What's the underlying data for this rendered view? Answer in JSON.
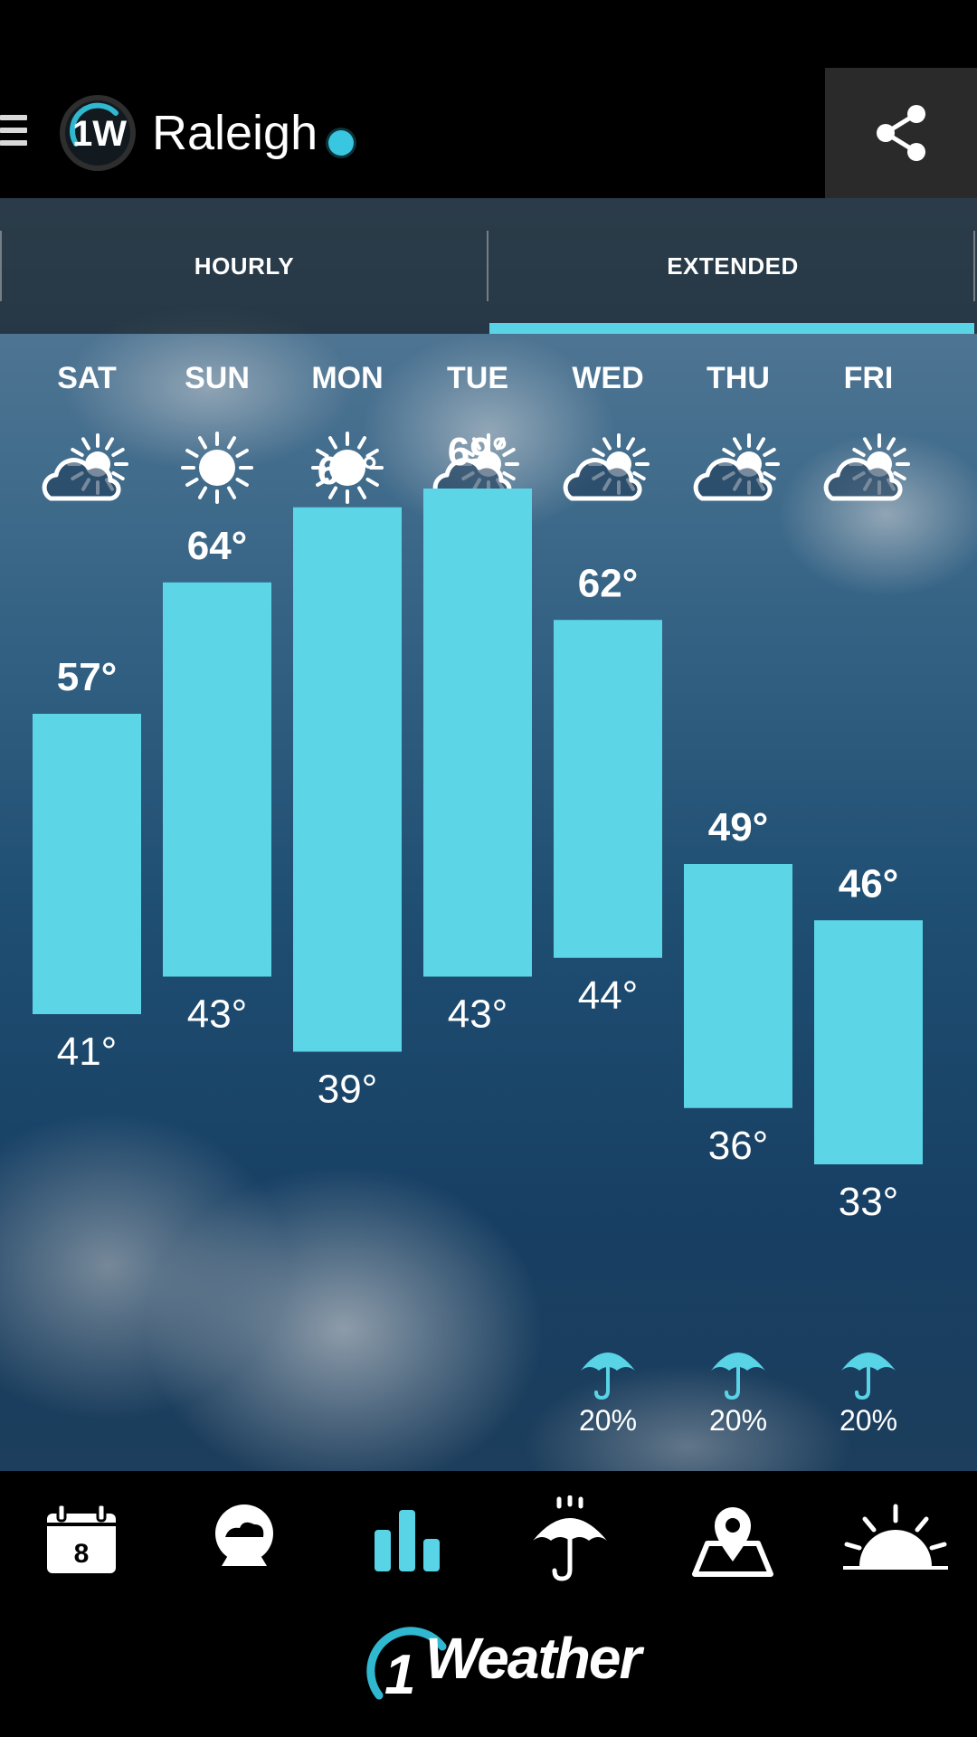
{
  "header": {
    "city": "Raleigh",
    "logo_text": "1W"
  },
  "tabs": [
    {
      "label": "HOURLY",
      "active": false
    },
    {
      "label": "EXTENDED",
      "active": true
    }
  ],
  "colors": {
    "accent": "#58d4e6",
    "bar": "#5cd6e6",
    "location_dot": "#39c6e0"
  },
  "chart_data": {
    "type": "bar",
    "categories": [
      "SAT",
      "SUN",
      "MON",
      "TUE",
      "WED",
      "THU",
      "FRI"
    ],
    "icons": [
      "partly-cloudy-icon",
      "sunny-icon",
      "sunny-icon",
      "partly-cloudy-icon",
      "partly-cloudy-icon",
      "partly-cloudy-icon",
      "partly-cloudy-icon"
    ],
    "high": [
      57,
      64,
      68,
      69,
      62,
      49,
      46
    ],
    "low": [
      41,
      43,
      39,
      43,
      44,
      36,
      33
    ],
    "high_labels": [
      "57°",
      "64°",
      "68°",
      "69°",
      "62°",
      "49°",
      "46°"
    ],
    "low_labels": [
      "41°",
      "43°",
      "39°",
      "43°",
      "44°",
      "36°",
      "33°"
    ],
    "precip_chance": [
      null,
      null,
      null,
      null,
      "20%",
      "20%",
      "20%"
    ]
  },
  "bottom_nav": [
    {
      "icon": "calendar-icon",
      "label": "8"
    },
    {
      "icon": "globe-icon"
    },
    {
      "icon": "bar-chart-icon",
      "active": true
    },
    {
      "icon": "umbrella-rain-icon"
    },
    {
      "icon": "map-pin-icon"
    },
    {
      "icon": "sunrise-icon"
    }
  ],
  "footer": {
    "brand": "Weather",
    "brand_prefix": "1"
  }
}
